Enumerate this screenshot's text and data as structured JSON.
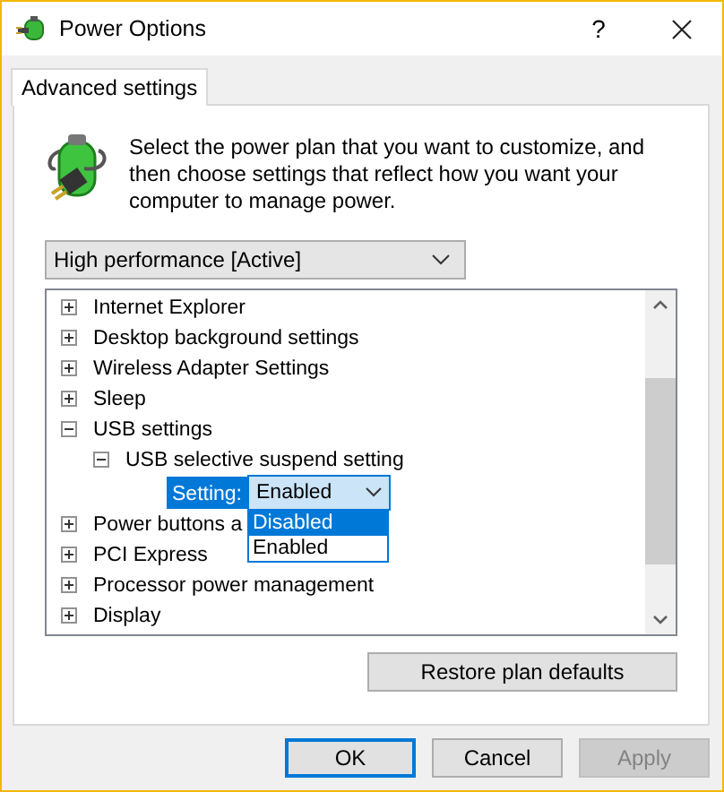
{
  "window": {
    "title": "Power Options",
    "help": "?"
  },
  "tabs": [
    {
      "label": "Advanced settings",
      "selected": true
    }
  ],
  "intro": "Select the power plan that you want to customize, and then choose settings that reflect how you want your computer to manage power.",
  "plan_dropdown": {
    "value": "High performance [Active]"
  },
  "settings_tree": {
    "items": [
      {
        "kind": "group",
        "label": "Internet Explorer",
        "expanded": false
      },
      {
        "kind": "group",
        "label": "Desktop background settings",
        "expanded": false
      },
      {
        "kind": "group",
        "label": "Wireless Adapter Settings",
        "expanded": false
      },
      {
        "kind": "group",
        "label": "Sleep",
        "expanded": false
      },
      {
        "kind": "group",
        "label": "USB settings",
        "expanded": true,
        "children": [
          {
            "kind": "group",
            "label": "USB selective suspend setting",
            "expanded": true,
            "children": [
              {
                "kind": "setting",
                "label": "Setting:",
                "selected": true,
                "value": "Enabled",
                "dropdown_open": true,
                "options": [
                  {
                    "label": "Disabled",
                    "highlighted": true
                  },
                  {
                    "label": "Enabled",
                    "highlighted": false
                  }
                ]
              }
            ]
          }
        ]
      },
      {
        "kind": "group",
        "label": "Power buttons a",
        "expanded": false
      },
      {
        "kind": "group",
        "label": "PCI Express",
        "expanded": false
      },
      {
        "kind": "group",
        "label": "Processor power management",
        "expanded": false
      },
      {
        "kind": "group",
        "label": "Display",
        "expanded": false
      }
    ]
  },
  "restore_button": "Restore plan defaults",
  "buttons": [
    {
      "label": "OK",
      "default": true,
      "disabled": false
    },
    {
      "label": "Cancel",
      "default": false,
      "disabled": false
    },
    {
      "label": "Apply",
      "default": false,
      "disabled": true
    }
  ]
}
